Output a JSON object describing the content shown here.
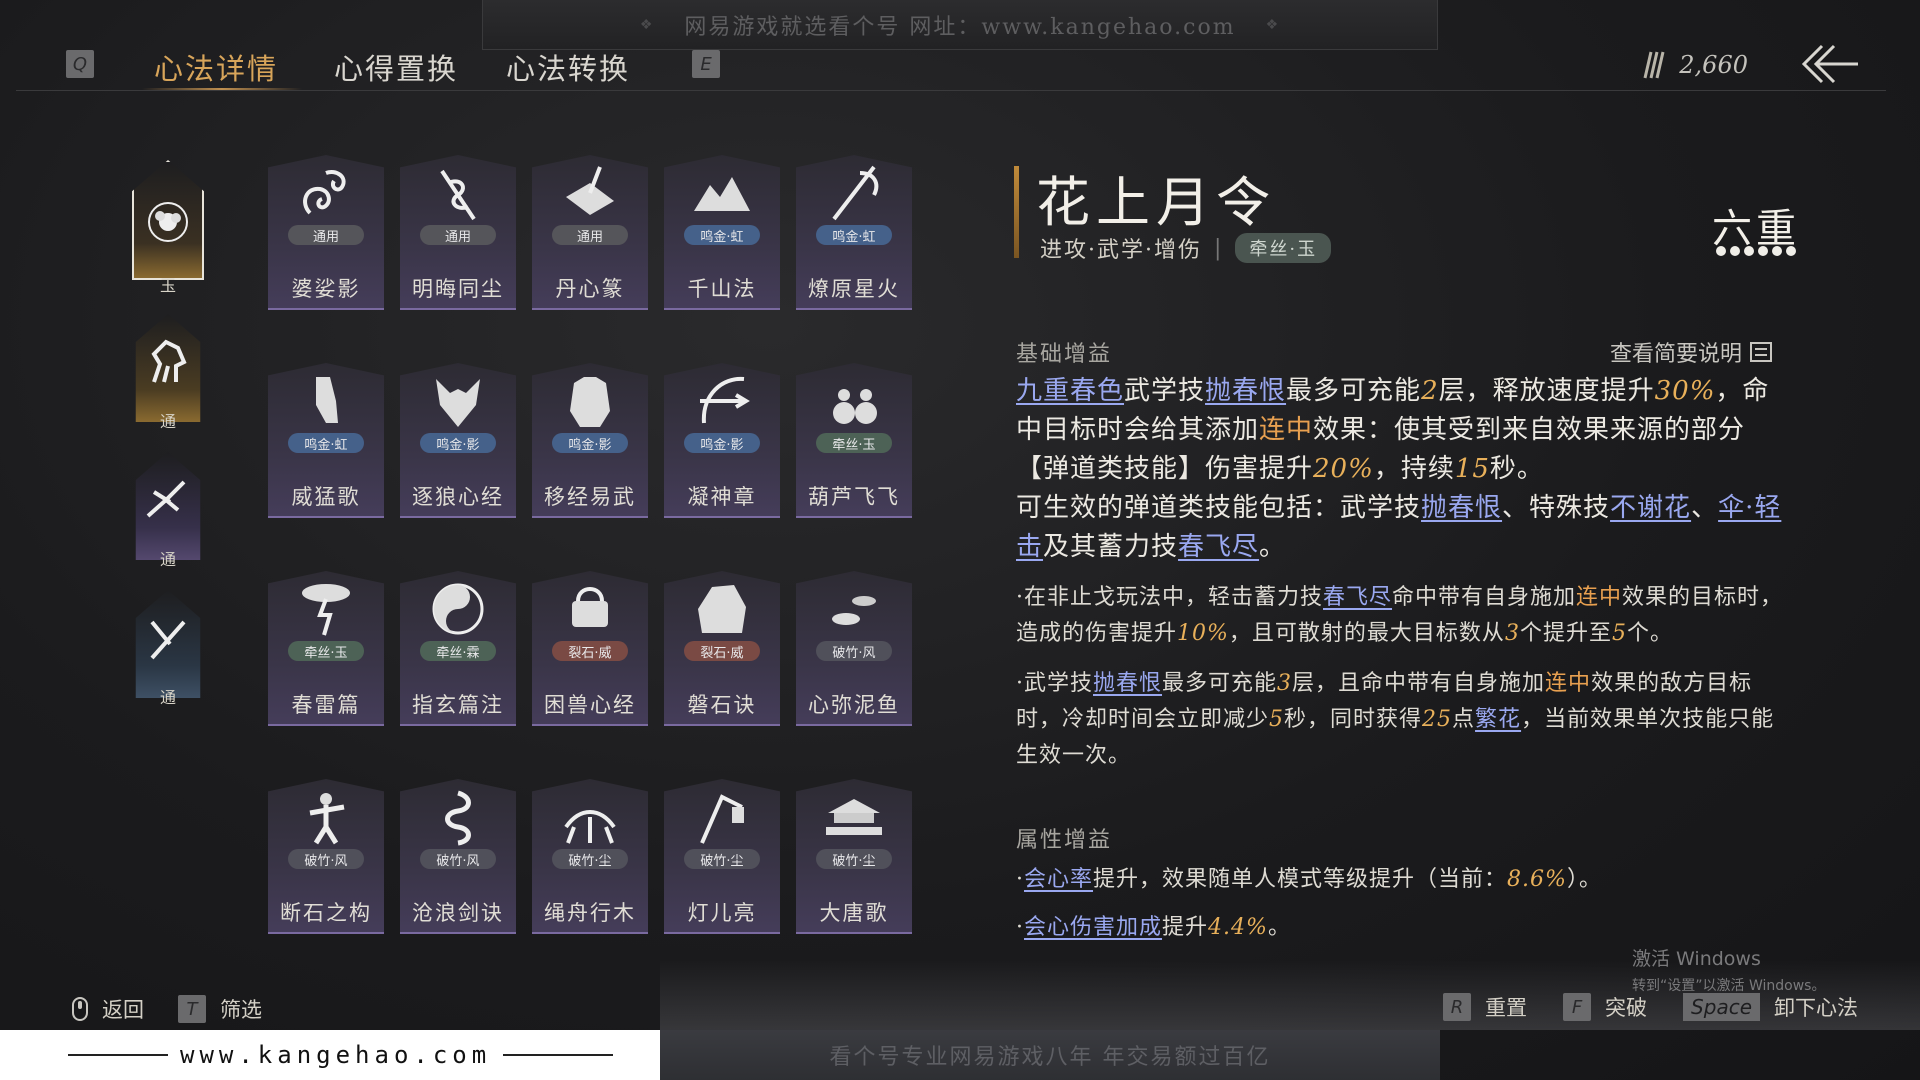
{
  "top_banner": {
    "text": "网易游戏就选看个号  网址：www.kangehao.com"
  },
  "tabs": {
    "prev_key": "Q",
    "next_key": "E",
    "items": [
      "心法详情",
      "心得置换",
      "心法转换"
    ],
    "active": "心法详情"
  },
  "currency": {
    "icon": "feather-coin-icon",
    "amount": "2,660"
  },
  "ranks": [
    {
      "label": "玉",
      "icon": "peony-emblem-icon",
      "selected": true
    },
    {
      "label": "通",
      "icon": "horse-icon"
    },
    {
      "label": "通",
      "icon": "eagle-icon"
    },
    {
      "label": "通",
      "icon": "blade-icon"
    }
  ],
  "cards": [
    {
      "name": "婆娑影",
      "tag": "通用",
      "tag_color": "#55555a",
      "icon": "dragon-icon"
    },
    {
      "name": "明晦同尘",
      "tag": "通用",
      "tag_color": "#55555a",
      "icon": "serpent-staff-icon"
    },
    {
      "name": "丹心篆",
      "tag": "通用",
      "tag_color": "#55555a",
      "icon": "brush-stone-icon"
    },
    {
      "name": "千山法",
      "tag": "鸣金·虹",
      "tag_color": "#45618a",
      "icon": "mountains-icon"
    },
    {
      "name": "燎原星火",
      "tag": "鸣金·虹",
      "tag_color": "#45618a",
      "icon": "spear-icon"
    },
    {
      "name": "威猛歌",
      "tag": "鸣金·虹",
      "tag_color": "#45618a",
      "icon": "gauntlet-icon"
    },
    {
      "name": "逐狼心经",
      "tag": "鸣金·影",
      "tag_color": "#45618a",
      "icon": "wolf-icon"
    },
    {
      "name": "移经易武",
      "tag": "鸣金·影",
      "tag_color": "#45618a",
      "icon": "armor-icon"
    },
    {
      "name": "凝神章",
      "tag": "鸣金·影",
      "tag_color": "#45618a",
      "icon": "bow-icon"
    },
    {
      "name": "葫芦飞飞",
      "tag": "牵丝·玉",
      "tag_color": "#4d6256",
      "icon": "gourd-icon"
    },
    {
      "name": "春雷篇",
      "tag": "牵丝·玉",
      "tag_color": "#4d6256",
      "icon": "lightning-tree-icon"
    },
    {
      "name": "指玄篇注",
      "tag": "牵丝·霖",
      "tag_color": "#4d6256",
      "icon": "yin-yang-icon"
    },
    {
      "name": "困兽心经",
      "tag": "裂石·威",
      "tag_color": "#7a4a44",
      "icon": "shackle-icon"
    },
    {
      "name": "磐石诀",
      "tag": "裂石·威",
      "tag_color": "#7a4a44",
      "icon": "boulder-icon"
    },
    {
      "name": "心弥泥鱼",
      "tag": "破竹·风",
      "tag_color": "#50505a",
      "icon": "koi-icon"
    },
    {
      "name": "断石之构",
      "tag": "破竹·风",
      "tag_color": "#50505a",
      "icon": "swordsman-icon"
    },
    {
      "name": "沧浪剑诀",
      "tag": "破竹·风",
      "tag_color": "#50505a",
      "icon": "coiled-dragon-icon"
    },
    {
      "name": "绳舟行木",
      "tag": "破竹·尘",
      "tag_color": "#50505a",
      "icon": "roots-icon"
    },
    {
      "name": "灯儿亮",
      "tag": "破竹·尘",
      "tag_color": "#50505a",
      "icon": "lantern-pole-icon"
    },
    {
      "name": "大唐歌",
      "tag": "破竹·尘",
      "tag_color": "#50505a",
      "icon": "palace-icon"
    }
  ],
  "detail": {
    "title": "花上月令",
    "tags": "进攻·武学·增伤",
    "badge": "牵丝·玉",
    "tier": "六重",
    "tier_level": 6,
    "basic_label": "基础增益",
    "view_brief": "查看简要说明",
    "p1": {
      "a": "九重春色",
      "b": "武学技",
      "c": "抛春恨",
      "d": "最多可充能",
      "e": "2",
      "f": "层，释放速度提升",
      "g": "30%",
      "h": "，命中目标时会给其添加",
      "i": "连中",
      "j": "效果：使其受到来自效果来源的部分【弹道类技能】伤害提升",
      "k": "20%",
      "l": "，持续",
      "m": "15",
      "n": "秒。"
    },
    "p2": {
      "a": "可生效的弹道类技能包括：武学技",
      "b": "抛春恨",
      "c": "、特殊技",
      "d": "不谢花",
      "e": "、",
      "f": "伞·轻击",
      "g": "及其蓄力技",
      "h": "春飞尽",
      "i": "。"
    },
    "p3": {
      "a": "·在非止戈玩法中，轻击蓄力技",
      "b": "春飞尽",
      "c": "命中带有自身施加",
      "d": "连中",
      "e": "效果的目标时，造成的伤害提升",
      "f": "10%",
      "g": "，且可散射的最大目标数从",
      "h": "3",
      "i": "个提升至",
      "j": "5",
      "k": "个。"
    },
    "p4": {
      "a": "·武学技",
      "b": "抛春恨",
      "c": "最多可充能",
      "d": "3",
      "e": "层，且命中带有自身施加",
      "f": "连中",
      "g": "效果的敌方目标时，冷却时间会立即减少",
      "h": "5",
      "i": "秒，同时获得",
      "j": "25",
      "k": "点",
      "l": "繁花",
      "m": "，当前效果单次技能只能生效一次。"
    },
    "attr_label": "属性增益",
    "attr1": {
      "a": "·",
      "b": "会心率",
      "c": "提升，效果随单人模式等级提升（当前：",
      "d": "8.6%",
      "e": "）。"
    },
    "attr2": {
      "a": "·",
      "b": "会心伤害加成",
      "c": "提升",
      "d": "4.4%",
      "e": "。"
    }
  },
  "activate": {
    "line1": "激活 Windows",
    "line2": "转到“设置”以激活 Windows。"
  },
  "footer_left": [
    {
      "key": "mouse",
      "label": "返回"
    },
    {
      "key": "T",
      "label": "筛选"
    }
  ],
  "footer_right": [
    {
      "key": "R",
      "label": "重置"
    },
    {
      "key": "F",
      "label": "突破"
    },
    {
      "key": "Space",
      "label": "卸下心法"
    }
  ],
  "watermark": {
    "site": "www.kangehao.com",
    "bottom_banner": "看个号专业网易游戏八年  年交易额过百亿"
  }
}
